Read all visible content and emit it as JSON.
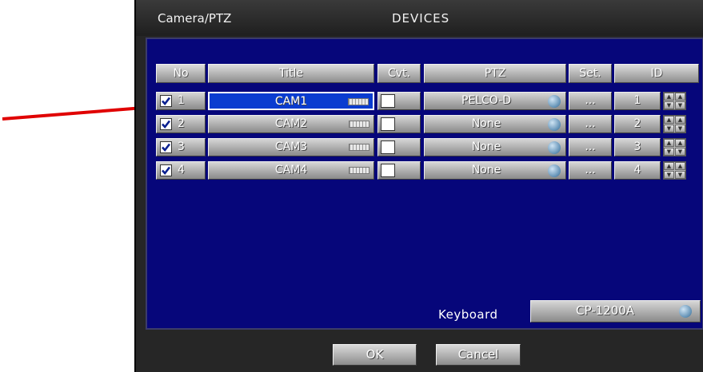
{
  "window": {
    "section_title": "Camera/PTZ",
    "tab_title": "DEVICES"
  },
  "table": {
    "headers": [
      "No",
      "Title",
      "Cvt.",
      "PTZ",
      "Set.",
      "ID"
    ],
    "rows": [
      {
        "checked": true,
        "no": "1",
        "title": "CAM1",
        "cvt": false,
        "ptz": "PELCO-D",
        "set": "...",
        "id": "1",
        "selected": true
      },
      {
        "checked": true,
        "no": "2",
        "title": "CAM2",
        "cvt": false,
        "ptz": "None",
        "set": "...",
        "id": "2",
        "selected": false
      },
      {
        "checked": true,
        "no": "3",
        "title": "CAM3",
        "cvt": false,
        "ptz": "None",
        "set": "...",
        "id": "3",
        "selected": false
      },
      {
        "checked": true,
        "no": "4",
        "title": "CAM4",
        "cvt": false,
        "ptz": "None",
        "set": "...",
        "id": "4",
        "selected": false
      }
    ]
  },
  "keyboard": {
    "label": "Keyboard",
    "value": "CP-1200A"
  },
  "buttons": {
    "ok": "OK",
    "cancel": "Cancel"
  },
  "icons": {
    "title_edit": "keyboard-icon",
    "dropdown": "dropdown-icon",
    "spinner": "up-down-spinner-icon"
  },
  "colors": {
    "panel_bg": "#06067a",
    "selected_cell": "#0a3cd0",
    "annotation_arrow": "#e00000"
  }
}
